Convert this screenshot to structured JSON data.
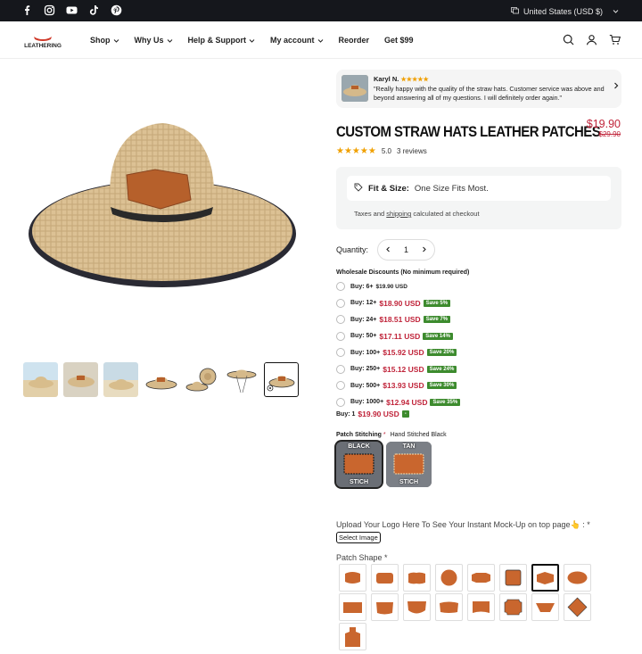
{
  "topbar": {
    "social": [
      "facebook-icon",
      "instagram-icon",
      "youtube-icon",
      "tiktok-icon",
      "pinterest-icon"
    ],
    "region": "United States (USD $)"
  },
  "header": {
    "logo": "LEATHERING",
    "nav": [
      {
        "label": "Shop",
        "dropdown": true
      },
      {
        "label": "Why Us",
        "dropdown": true
      },
      {
        "label": "Help & Support",
        "dropdown": true
      },
      {
        "label": "My account",
        "dropdown": true
      },
      {
        "label": "Reorder",
        "dropdown": false
      },
      {
        "label": "Get $99",
        "dropdown": false
      }
    ],
    "icons": [
      "search-icon",
      "account-icon",
      "cart-icon"
    ]
  },
  "review": {
    "name": "Karyl N.",
    "stars": "★★★★★",
    "text": "\"Really happy with the quality of the straw hats. Customer service was above and beyond answering all of my questions. I will definitely order again.\""
  },
  "product": {
    "title": "CUSTOM STRAW HATS LEATHER PATCHES",
    "price": "$19.90",
    "compare_price": "$29.90",
    "rating_stars": "★★★★★",
    "rating_value": "5.0",
    "reviews": "3 reviews",
    "fit_label": "Fit & Size:",
    "fit_value": "One Size Fits Most.",
    "tax_prefix": "Taxes and",
    "tax_link": "shipping",
    "tax_suffix": "calculated at checkout",
    "quantity_label": "Quantity:",
    "quantity": "1"
  },
  "wholesale": {
    "title": "Wholesale Discounts (No minimum required)",
    "rows": [
      {
        "label": "Buy: 6+",
        "price": "$19.90 USD",
        "badge": "",
        "small": true
      },
      {
        "label": "Buy: 12+",
        "price": "$18.90 USD",
        "badge": "Save 5%"
      },
      {
        "label": "Buy: 24+",
        "price": "$18.51 USD",
        "badge": "Save 7%"
      },
      {
        "label": "Buy: 50+",
        "price": "$17.11 USD",
        "badge": "Save 14%"
      },
      {
        "label": "Buy: 100+",
        "price": "$15.92 USD",
        "badge": "Save 20%"
      },
      {
        "label": "Buy: 250+",
        "price": "$15.12 USD",
        "badge": "Save 24%"
      },
      {
        "label": "Buy: 500+",
        "price": "$13.93 USD",
        "badge": "Save 30%"
      },
      {
        "label": "Buy: 1000+",
        "price": "$12.94 USD",
        "badge": "Save 35%"
      }
    ],
    "buy_one_label": "Buy: 1",
    "buy_one_price": "$19.90 USD",
    "buy_one_badge": "-"
  },
  "stitching": {
    "label": "Patch Stitching",
    "required": "*",
    "value": "Hand Stitched Black",
    "options": [
      {
        "top": "BLACK",
        "bottom": "STICH"
      },
      {
        "top": "TAN",
        "bottom": "STICH"
      }
    ]
  },
  "upload": {
    "label": "Upload Your Logo Here To See Your Instant Mock-Up on top page👆 : *",
    "button": "Select Image"
  },
  "patch_shape": {
    "label": "Patch Shape *"
  }
}
